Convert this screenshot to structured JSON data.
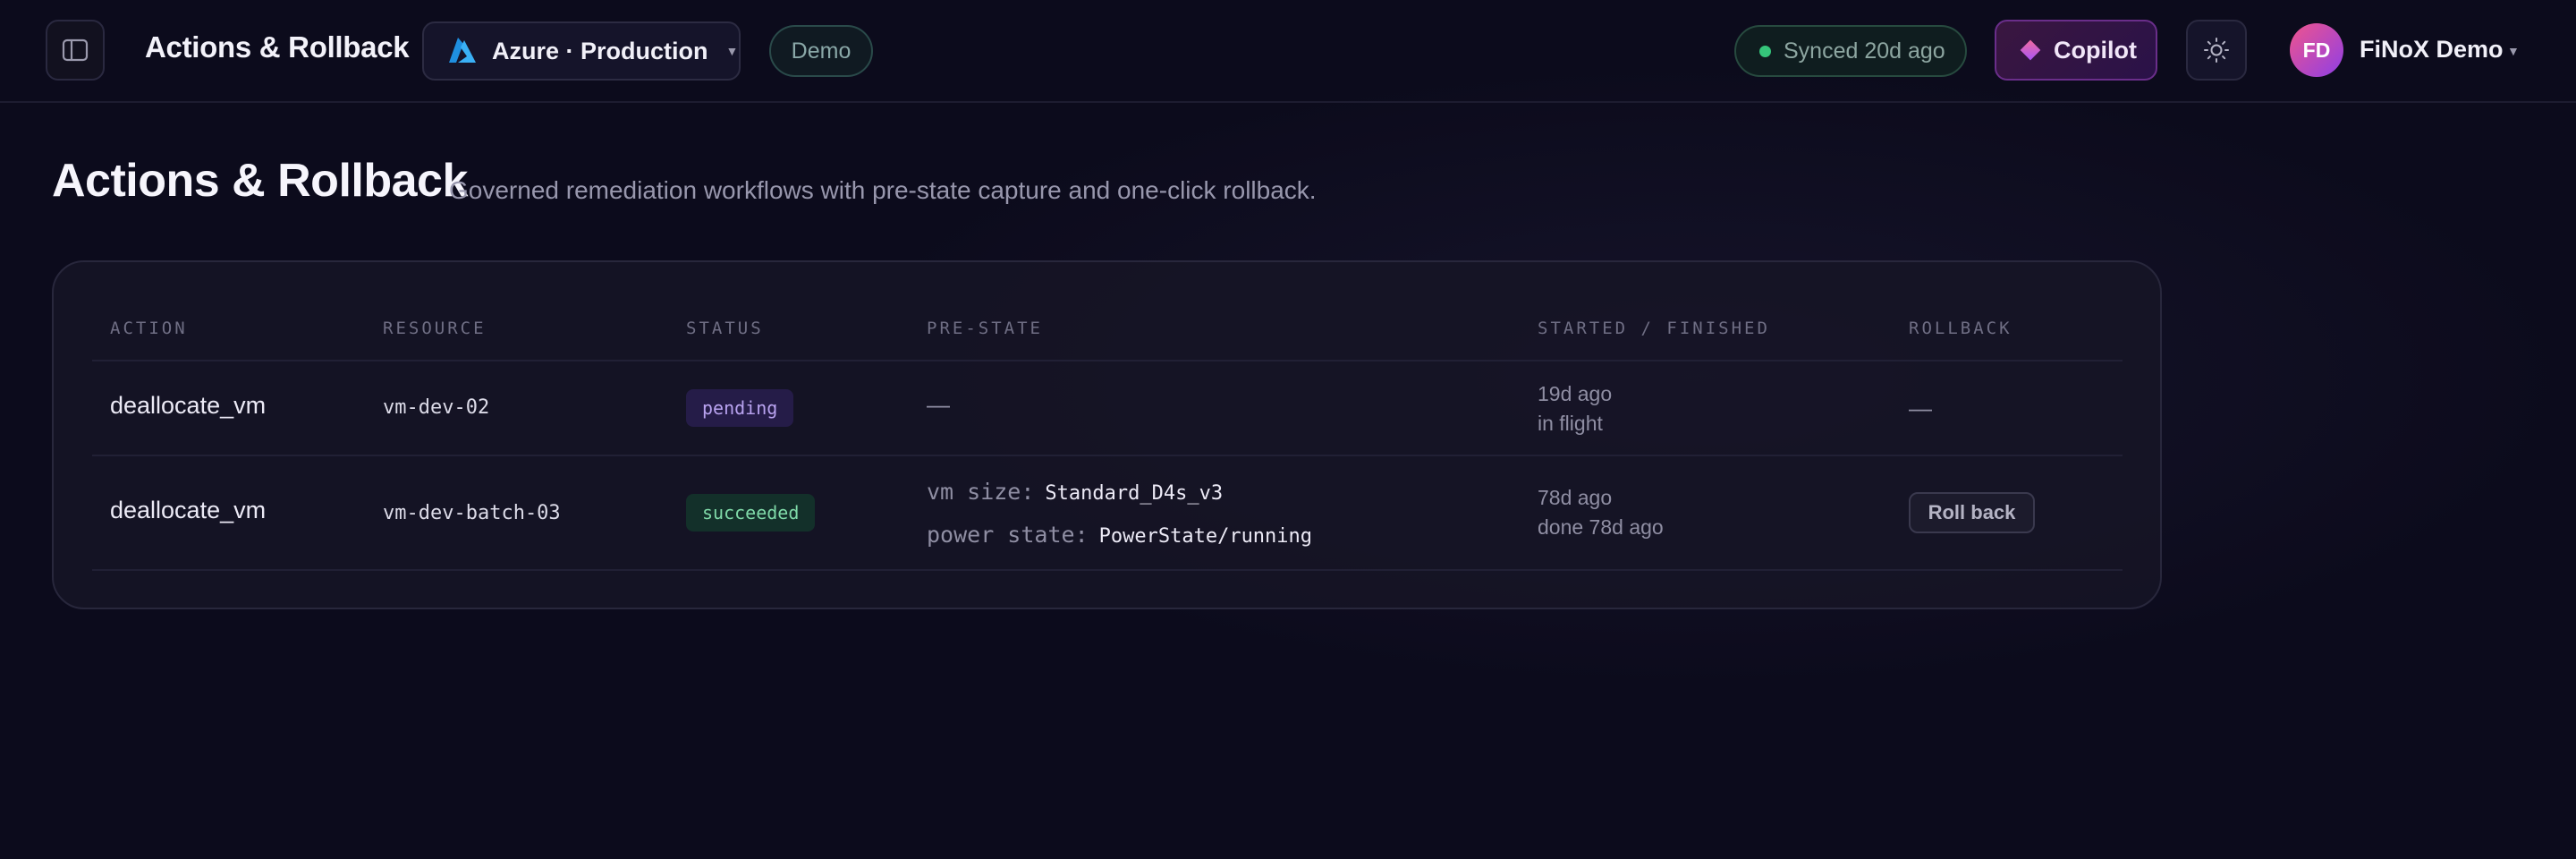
{
  "header": {
    "title": "Actions & Rollback",
    "cloud": "Azure · Production",
    "demo_badge": "Demo",
    "sync_status": "Synced 20d ago",
    "copilot_label": "Copilot",
    "user": {
      "initials": "FD",
      "name": "FiNoX Demo"
    }
  },
  "page": {
    "title": "Actions & Rollback",
    "subtitle": "Governed remediation workflows with pre-state capture and one-click rollback."
  },
  "table": {
    "columns": [
      "ACTION",
      "RESOURCE",
      "STATUS",
      "PRE-STATE",
      "STARTED / FINISHED",
      "ROLLBACK"
    ],
    "rows": [
      {
        "action": "deallocate_vm",
        "resource": "vm-dev-02",
        "status": "pending",
        "pre_state": "—",
        "started": "19d ago",
        "finished": "in flight",
        "rollback": "—"
      },
      {
        "action": "deallocate_vm",
        "resource": "vm-dev-batch-03",
        "status": "succeeded",
        "pre_state_items": [
          {
            "key": "vm size:",
            "value": "Standard_D4s_v3"
          },
          {
            "key": "power state:",
            "value": "PowerState/running"
          }
        ],
        "started": "78d ago",
        "finished": "done 78d ago",
        "rollback": "Roll back"
      }
    ]
  },
  "colors": {
    "background": "#0c0b1c",
    "accent_copilot": "#a855f7",
    "status_pending": "#b9a3f0",
    "status_succeeded": "#7fd9a8",
    "sync_dot": "#35c57a"
  },
  "icons": {
    "sidebar_toggle": "sidebar-panel-icon",
    "cloud": "azure-logo-icon",
    "theme": "sun-icon",
    "copilot": "diamond-icon"
  }
}
